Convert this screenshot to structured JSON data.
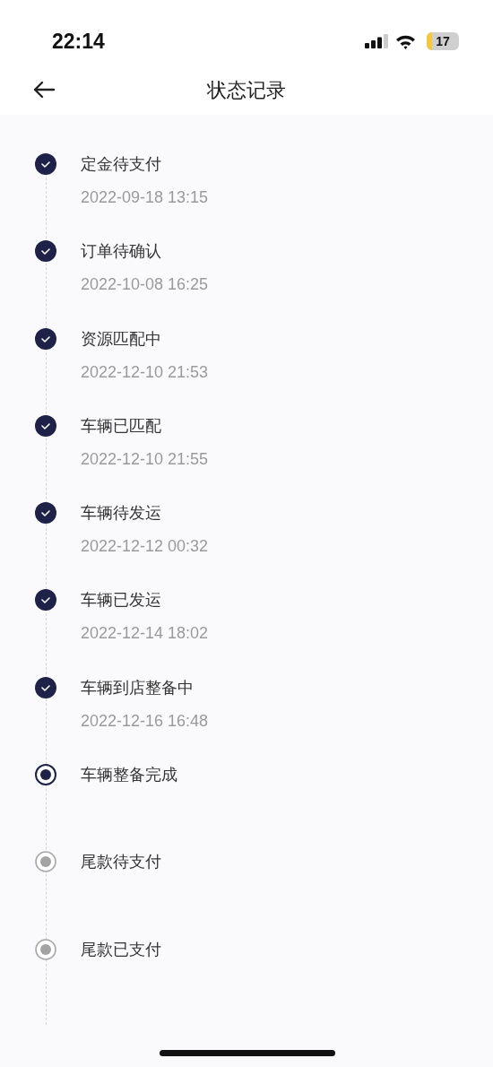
{
  "status_bar": {
    "time": "22:14",
    "battery": "17"
  },
  "header": {
    "title": "状态记录"
  },
  "steps": [
    {
      "title": "定金待支付",
      "time": "2022-09-18 13:15",
      "kind": "done"
    },
    {
      "title": "订单待确认",
      "time": "2022-10-08 16:25",
      "kind": "done"
    },
    {
      "title": "资源匹配中",
      "time": "2022-12-10 21:53",
      "kind": "done"
    },
    {
      "title": "车辆已匹配",
      "time": "2022-12-10 21:55",
      "kind": "done"
    },
    {
      "title": "车辆待发运",
      "time": "2022-12-12 00:32",
      "kind": "done"
    },
    {
      "title": "车辆已发运",
      "time": "2022-12-14 18:02",
      "kind": "done"
    },
    {
      "title": "车辆到店整备中",
      "time": "2022-12-16 16:48",
      "kind": "done"
    },
    {
      "title": "车辆整备完成",
      "kind": "current"
    },
    {
      "title": "尾款待支付",
      "kind": "pending"
    },
    {
      "title": "尾款已支付",
      "kind": "pending"
    }
  ]
}
